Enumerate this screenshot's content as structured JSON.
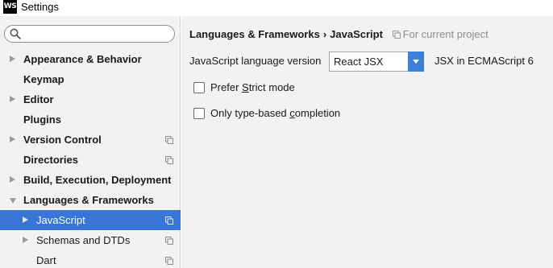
{
  "window": {
    "icon_text": "WS",
    "title": "Settings"
  },
  "search": {
    "placeholder": ""
  },
  "sidebar": {
    "items": [
      {
        "label": "Appearance & Behavior",
        "bold": true,
        "arrow": "right",
        "copy": false,
        "selected": false
      },
      {
        "label": "Keymap",
        "bold": true,
        "arrow": "none",
        "copy": false,
        "selected": false
      },
      {
        "label": "Editor",
        "bold": true,
        "arrow": "right",
        "copy": false,
        "selected": false
      },
      {
        "label": "Plugins",
        "bold": true,
        "arrow": "none",
        "copy": false,
        "selected": false
      },
      {
        "label": "Version Control",
        "bold": true,
        "arrow": "right",
        "copy": true,
        "selected": false
      },
      {
        "label": "Directories",
        "bold": true,
        "arrow": "none",
        "copy": true,
        "selected": false
      },
      {
        "label": "Build, Execution, Deployment",
        "bold": true,
        "arrow": "right",
        "copy": false,
        "selected": false
      },
      {
        "label": "Languages & Frameworks",
        "bold": true,
        "arrow": "down",
        "copy": false,
        "selected": false
      },
      {
        "label": "JavaScript",
        "bold": false,
        "arrow": "right",
        "copy": true,
        "selected": true
      },
      {
        "label": "Schemas and DTDs",
        "bold": false,
        "arrow": "right",
        "copy": true,
        "selected": false
      },
      {
        "label": "Dart",
        "bold": false,
        "arrow": "none",
        "copy": true,
        "selected": false
      }
    ]
  },
  "breadcrumb": {
    "parent": "Languages & Frameworks",
    "separator": "›",
    "current": "JavaScript",
    "scope": "For current project"
  },
  "language": {
    "label": "JavaScript language version",
    "selected": "React JSX",
    "note": "JSX in ECMAScript 6"
  },
  "options": {
    "strict": {
      "before": "Prefer ",
      "mnemonic": "S",
      "after": "trict mode",
      "checked": false
    },
    "completion": {
      "before": "Only type-based ",
      "mnemonic": "c",
      "after": "ompletion",
      "checked": false
    }
  },
  "colors": {
    "selection": "#3875d7",
    "dropdown_button": "#3d80d9",
    "panel_bg": "#f2f2f2"
  }
}
